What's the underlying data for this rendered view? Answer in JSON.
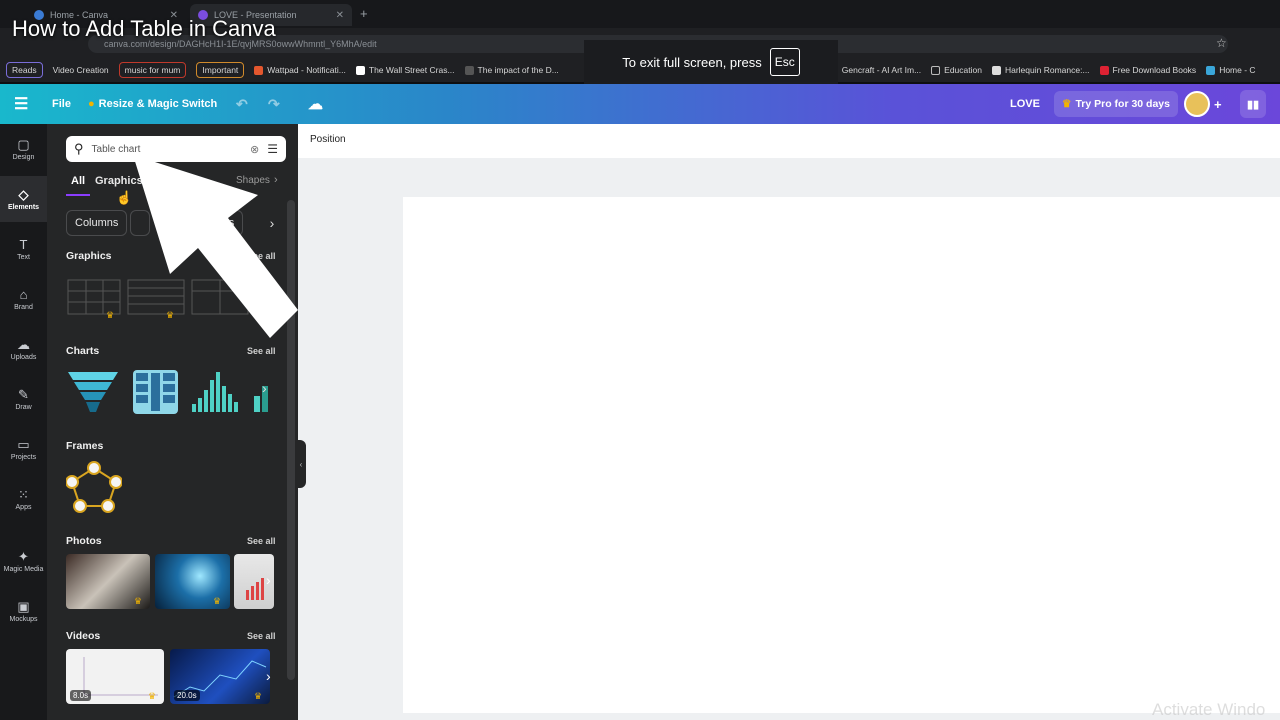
{
  "video_title": "How to Add Table in Canva",
  "browser": {
    "tabs": [
      {
        "title": "Home - Canva"
      },
      {
        "title": "LOVE - Presentation"
      }
    ],
    "new_tab": "+",
    "url": "canva.com/design/DAGHcH1I-1E/qvjMRS0owwWhmntl_Y6MhA/edit",
    "bookmarks_tags": [
      "Reads",
      "Video Creation",
      "music for mum",
      "Important"
    ],
    "bookmarks": [
      "Wattpad - Notificati...",
      "The Wall Street Cras...",
      "The impact of the D...",
      "Gencraft - AI Art Im...",
      "Education",
      "Harlequin Romance:...",
      "Free Download Books",
      "Home - C"
    ]
  },
  "fullscreen_notice": {
    "text": "To exit full screen, press",
    "key": "Esc"
  },
  "topbar": {
    "file": "File",
    "resize": "Resize & Magic Switch",
    "doc_name": "LOVE",
    "try_pro": "Try Pro for 30 days"
  },
  "rail": [
    {
      "label": "Design",
      "icon": "design-icon",
      "glyph": "▢"
    },
    {
      "label": "Elements",
      "icon": "elements-icon",
      "glyph": "◇"
    },
    {
      "label": "Text",
      "icon": "text-icon",
      "glyph": "T"
    },
    {
      "label": "Brand",
      "icon": "brand-icon",
      "glyph": "⌂"
    },
    {
      "label": "Uploads",
      "icon": "uploads-icon",
      "glyph": "☁"
    },
    {
      "label": "Draw",
      "icon": "draw-icon",
      "glyph": "✎"
    },
    {
      "label": "Projects",
      "icon": "projects-icon",
      "glyph": "▭"
    },
    {
      "label": "Apps",
      "icon": "apps-icon",
      "glyph": "⁙"
    },
    {
      "label": "Magic Media",
      "icon": "magic-media-icon",
      "glyph": "✦"
    },
    {
      "label": "Mockups",
      "icon": "mockups-icon",
      "glyph": "▣"
    }
  ],
  "panel": {
    "search_value": "Table chart",
    "tabs": {
      "all": "All",
      "graphics": "Graphics",
      "shapes": "Shapes"
    },
    "pills": {
      "columns": "Columns",
      "triangles": "ngles"
    },
    "sections": {
      "graphics": {
        "title": "Graphics",
        "see_all": "See all"
      },
      "charts": {
        "title": "Charts",
        "see_all": "See all"
      },
      "frames": {
        "title": "Frames"
      },
      "photos": {
        "title": "Photos",
        "see_all": "See all"
      },
      "videos": {
        "title": "Videos",
        "see_all": "See all",
        "durations": [
          "8.0s",
          "20.0s"
        ]
      }
    }
  },
  "canvas": {
    "position_label": "Position",
    "watermark": "Activate Windo"
  },
  "colors": {
    "accent": "#8b3dff",
    "topbar_start": "#19b8cc",
    "topbar_end": "#6b47da"
  }
}
